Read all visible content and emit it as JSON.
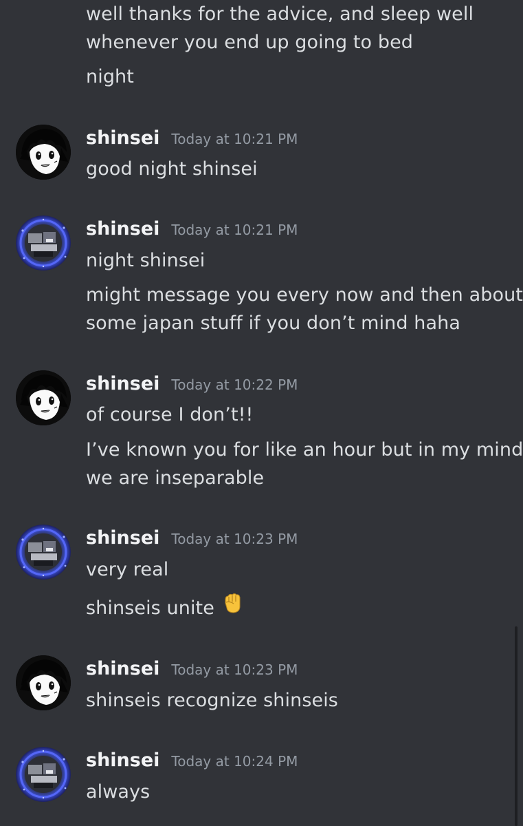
{
  "messages": {
    "m0": {
      "line1": "well thanks for the advice, and sleep well",
      "line2": "whenever you end up going to bed",
      "line3": "night"
    },
    "m1": {
      "author": "shinsei",
      "time": "Today at 10:21 PM",
      "line1": "good night shinsei"
    },
    "m2": {
      "author": "shinsei",
      "time": "Today at 10:21 PM",
      "line1": "night shinsei",
      "line2": "might message you every now and then about",
      "line3": "some japan stuff if you don’t mind haha"
    },
    "m3": {
      "author": "shinsei",
      "time": "Today at 10:22 PM",
      "line1": "of course I don’t!!",
      "line2": "I’ve known you for like an hour but in my mind",
      "line3": "we are inseparable"
    },
    "m4": {
      "author": "shinsei",
      "time": "Today at 10:23 PM",
      "line1": "very real",
      "line2": "shinseis unite",
      "emoji": "raised-fist-emoji"
    },
    "m5": {
      "author": "shinsei",
      "time": "Today at 10:23 PM",
      "line1": "shinseis recognize shinseis"
    },
    "m6": {
      "author": "shinsei",
      "time": "Today at 10:24 PM",
      "line1": "always"
    }
  },
  "colors": {
    "background": "#313338",
    "text": "#dbdee1",
    "author": "#f2f3f5",
    "timestamp": "#949ba4",
    "avatar_blue_glow": "#4a5bd8"
  },
  "icons": {
    "avatar_a": "anime-character-avatar",
    "avatar_b": "blue-ring-avatar"
  }
}
